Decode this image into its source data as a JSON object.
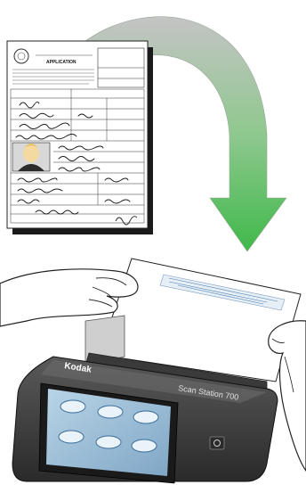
{
  "illustration": {
    "kind": "document-scanning illustration",
    "form": {
      "title": "APPLICATION"
    },
    "device": {
      "brand": "Kodak",
      "model": "Scan Station 700"
    },
    "touchscreen": {
      "button_count": 6
    },
    "arrow": {
      "gradient_top": "#b8b8b8",
      "gradient_bottom": "#3fb94a"
    }
  }
}
